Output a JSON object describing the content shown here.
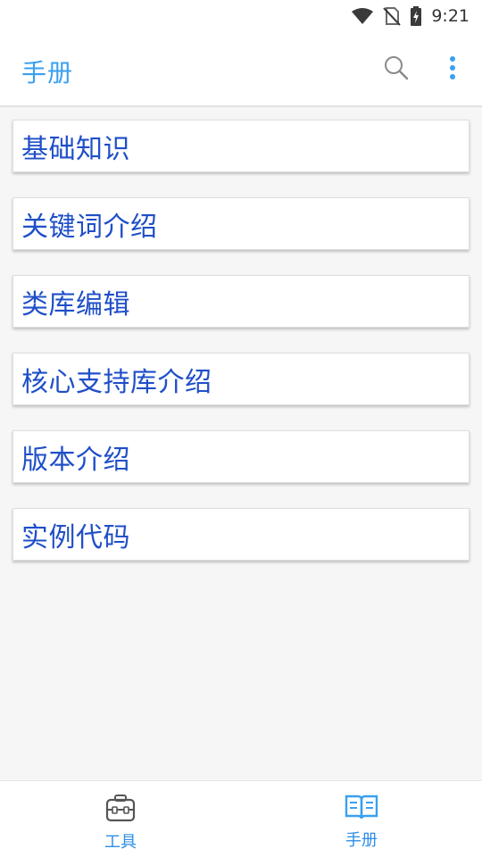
{
  "status_bar": {
    "time": "9:21",
    "icons": [
      "wifi-icon",
      "no-sim-icon",
      "battery-charging-icon"
    ]
  },
  "app_bar": {
    "title": "手册",
    "actions": [
      "search-icon",
      "more-vert-icon"
    ]
  },
  "manual_items": [
    {
      "label": "基础知识"
    },
    {
      "label": "关键词介绍"
    },
    {
      "label": "类库编辑"
    },
    {
      "label": "核心支持库介绍"
    },
    {
      "label": "版本介绍"
    },
    {
      "label": "实例代码"
    }
  ],
  "bottom_nav": {
    "items": [
      {
        "label": "工具",
        "icon": "toolbox-icon",
        "active": false
      },
      {
        "label": "手册",
        "icon": "open-book-icon",
        "active": true
      }
    ]
  },
  "colors": {
    "accent": "#3aa0f0",
    "item_text": "#1f4fc8",
    "background": "#f6f6f6"
  }
}
